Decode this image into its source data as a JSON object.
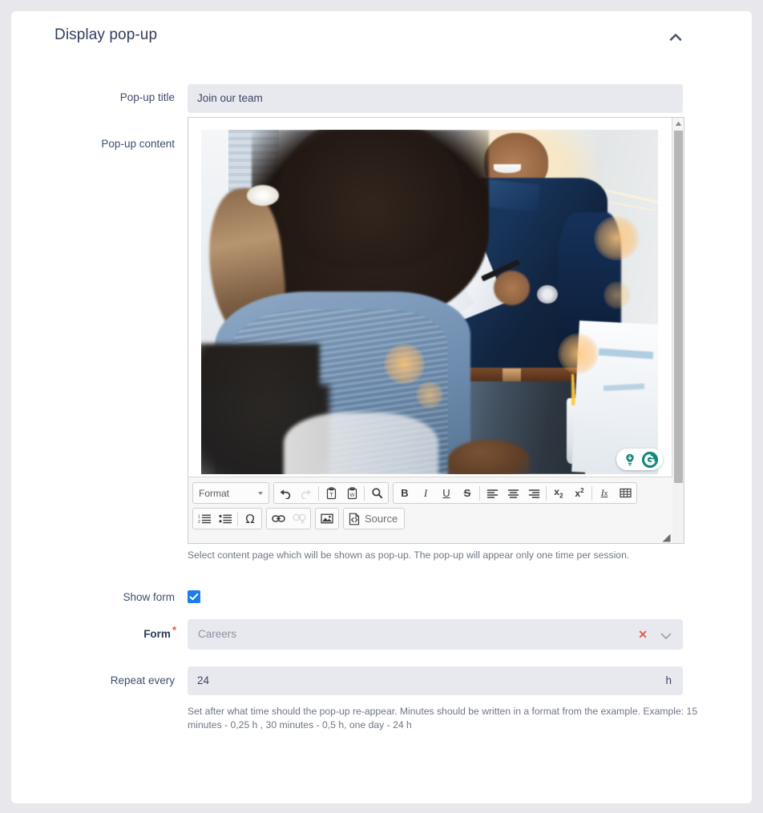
{
  "panel": {
    "title": "Display pop-up",
    "collapse_icon": "chevron-up-icon"
  },
  "fields": {
    "popup_title": {
      "label": "Pop-up title",
      "value": "Join our team"
    },
    "popup_content": {
      "label": "Pop-up content",
      "help": "Select content page which will be shown as pop-up. The pop-up will appear only one time per session."
    },
    "show_form": {
      "label": "Show form",
      "checked": true
    },
    "form": {
      "label": "Form",
      "required_marker": "*",
      "value": "Careers",
      "clear_icon": "close-icon",
      "caret_icon": "chevron-down-icon"
    },
    "repeat_every": {
      "label": "Repeat every",
      "value": "24",
      "unit": "h",
      "help": "Set after what time should the pop-up re-appear. Minutes should be written in a format from the example. Example: 15 minutes - 0,25 h , 30 minutes - 0,5 h, one day - 24 h"
    }
  },
  "editor": {
    "format_label": "Format",
    "source_label": "Source",
    "toolbar_row1": [
      {
        "name": "undo-icon",
        "glyph": "↩",
        "disabled": false
      },
      {
        "name": "redo-icon",
        "glyph": "↪",
        "disabled": true
      },
      {
        "name": "paste-as-plain-text-icon",
        "glyph": "T",
        "disabled": false
      },
      {
        "name": "paste-from-word-icon",
        "glyph": "W",
        "disabled": false
      },
      {
        "name": "find-icon",
        "glyph": "⚲",
        "disabled": false
      },
      {
        "name": "bold-icon",
        "glyph": "B",
        "disabled": false
      },
      {
        "name": "italic-icon",
        "glyph": "I",
        "disabled": false
      },
      {
        "name": "underline-icon",
        "glyph": "U",
        "disabled": false
      },
      {
        "name": "strikethrough-icon",
        "glyph": "S",
        "disabled": false
      },
      {
        "name": "align-left-icon",
        "glyph": "☰",
        "disabled": false
      },
      {
        "name": "align-center-icon",
        "glyph": "☰",
        "disabled": false
      },
      {
        "name": "align-right-icon",
        "glyph": "☰",
        "disabled": false
      },
      {
        "name": "subscript-icon",
        "glyph": "x₂",
        "disabled": false
      },
      {
        "name": "superscript-icon",
        "glyph": "x²",
        "disabled": false
      },
      {
        "name": "remove-format-icon",
        "glyph": "Iₓ",
        "disabled": false
      },
      {
        "name": "table-icon",
        "glyph": "▦",
        "disabled": false
      }
    ],
    "toolbar_row2": [
      {
        "name": "numbered-list-icon",
        "glyph": "1≡",
        "disabled": false
      },
      {
        "name": "bulleted-list-icon",
        "glyph": "•≡",
        "disabled": false
      },
      {
        "name": "special-character-icon",
        "glyph": "Ω",
        "disabled": false
      },
      {
        "name": "link-icon",
        "glyph": "⚭",
        "disabled": false
      },
      {
        "name": "unlink-icon",
        "glyph": "⚭",
        "disabled": true
      },
      {
        "name": "image-icon",
        "glyph": "⛰",
        "disabled": false
      },
      {
        "name": "source-icon",
        "glyph": "</>",
        "disabled": false
      }
    ],
    "scrollbar": {
      "up_arrow_icon": "caret-up-icon"
    },
    "resize_grip_icon": "resize-grip-icon",
    "grammarly": {
      "assistant_icon": "lightbulb-icon",
      "logo_icon": "grammarly-g-icon",
      "color": "#15877a"
    }
  },
  "colors": {
    "page_background": "#e8e8ec",
    "card_background": "#ffffff",
    "input_background": "#e8e9ee",
    "label_text": "#3d4d6e",
    "title_text": "#313d5c",
    "help_text": "#6f7685",
    "checkbox_accent": "#1b7ced",
    "required_star": "#e8573f",
    "clear_icon": "#e05a4f"
  }
}
